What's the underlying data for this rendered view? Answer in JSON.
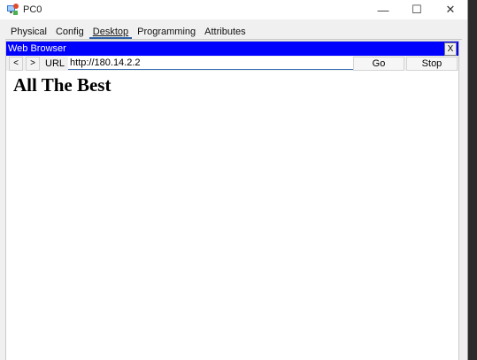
{
  "window": {
    "title": "PC0",
    "controls": {
      "minimize": "—",
      "maximize": "☐",
      "close": "✕"
    }
  },
  "tabs": [
    {
      "label": "Physical",
      "active": false
    },
    {
      "label": "Config",
      "active": false
    },
    {
      "label": "Desktop",
      "active": true
    },
    {
      "label": "Programming",
      "active": false
    },
    {
      "label": "Attributes",
      "active": false
    }
  ],
  "browser": {
    "title": "Web Browser",
    "close_label": "X",
    "back_label": "<",
    "forward_label": ">",
    "url_label": "URL",
    "url_value": "http://180.14.2.2",
    "go_label": "Go",
    "stop_label": "Stop",
    "page_heading": "All The Best"
  },
  "colors": {
    "browser_titlebar": "#0000ff",
    "tab_underline": "#2b5fa8"
  }
}
